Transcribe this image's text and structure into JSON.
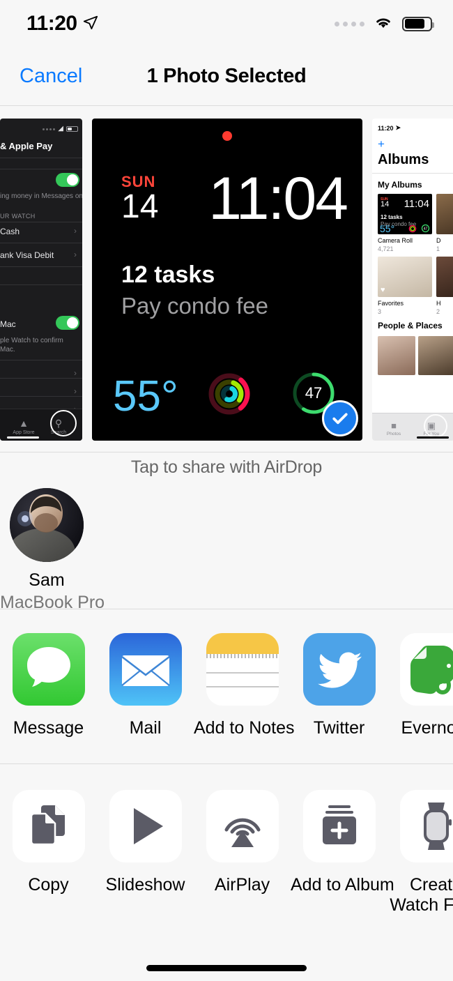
{
  "status_bar": {
    "time": "11:20",
    "location_icon": "location-arrow-icon",
    "signal_icon": "cellular-dots-icon",
    "wifi_icon": "wifi-icon",
    "battery_icon": "battery-icon"
  },
  "navbar": {
    "cancel_label": "Cancel",
    "title": "1 Photo Selected"
  },
  "previews": {
    "left": {
      "name": "apple-pay-settings-screenshot",
      "header": "& Apple Pay",
      "toggle_caption": "ing money in Messages on",
      "group_header": "UR WATCH",
      "row_cash": "Cash",
      "row_visa": "ank Visa Debit",
      "row_mac": "Mac",
      "mac_caption_line1": "ple Watch to confirm",
      "mac_caption_line2": "Mac.",
      "tab_app_store": "App Store",
      "tab_search": "Search"
    },
    "center": {
      "name": "apple-watch-face-screenshot",
      "weekday": "SUN",
      "date": "14",
      "time": "11:04",
      "tasks_title": "12 tasks",
      "tasks_subtitle": "Pay condo fee",
      "temperature": "55°",
      "activity_rings": "activity-rings-complication",
      "score": "47",
      "selected": true
    },
    "right": {
      "name": "photos-albums-screenshot",
      "status_time": "11:20",
      "add_label": "+",
      "title": "Albums",
      "section_my_albums": "My Albums",
      "album1_name": "Camera Roll",
      "album1_count": "4,721",
      "album1_thumb_weekday": "SUN",
      "album1_thumb_date": "14",
      "album1_thumb_time": "11:04",
      "album1_thumb_tasks": "12 tasks",
      "album1_thumb_sub": "Pay condo fee",
      "album1_thumb_temp": "55°",
      "album2_name": "D",
      "album2_count": "1",
      "album3_name": "Favorites",
      "album3_count": "3",
      "album4_name": "H",
      "album4_count": "2",
      "section_people_places": "People & Places",
      "tab_photos": "Photos",
      "tab_for_you": "For You"
    }
  },
  "airdrop": {
    "hint": "Tap to share with AirDrop",
    "contacts": [
      {
        "name": "Sam",
        "device": "MacBook Pro"
      }
    ]
  },
  "apps": [
    {
      "label": "Message",
      "icon": "messages-icon"
    },
    {
      "label": "Mail",
      "icon": "mail-icon"
    },
    {
      "label": "Add to Notes",
      "icon": "notes-icon"
    },
    {
      "label": "Twitter",
      "icon": "twitter-icon"
    },
    {
      "label": "Evernote",
      "icon": "evernote-icon"
    }
  ],
  "actions": [
    {
      "label": "Copy",
      "icon": "copy-icon"
    },
    {
      "label": "Slideshow",
      "icon": "play-icon"
    },
    {
      "label": "AirPlay",
      "icon": "airplay-icon"
    },
    {
      "label": "Add to Album",
      "icon": "add-to-album-icon"
    },
    {
      "label": "Create Watch Face",
      "icon": "apple-watch-icon"
    }
  ],
  "colors": {
    "accent_blue": "#0a7aff",
    "check_blue": "#1a7ced",
    "background": "#f7f7f7",
    "toggle_green": "#34c759",
    "watch_red": "#ff453a",
    "watch_temp_blue": "#5ac8fa"
  }
}
